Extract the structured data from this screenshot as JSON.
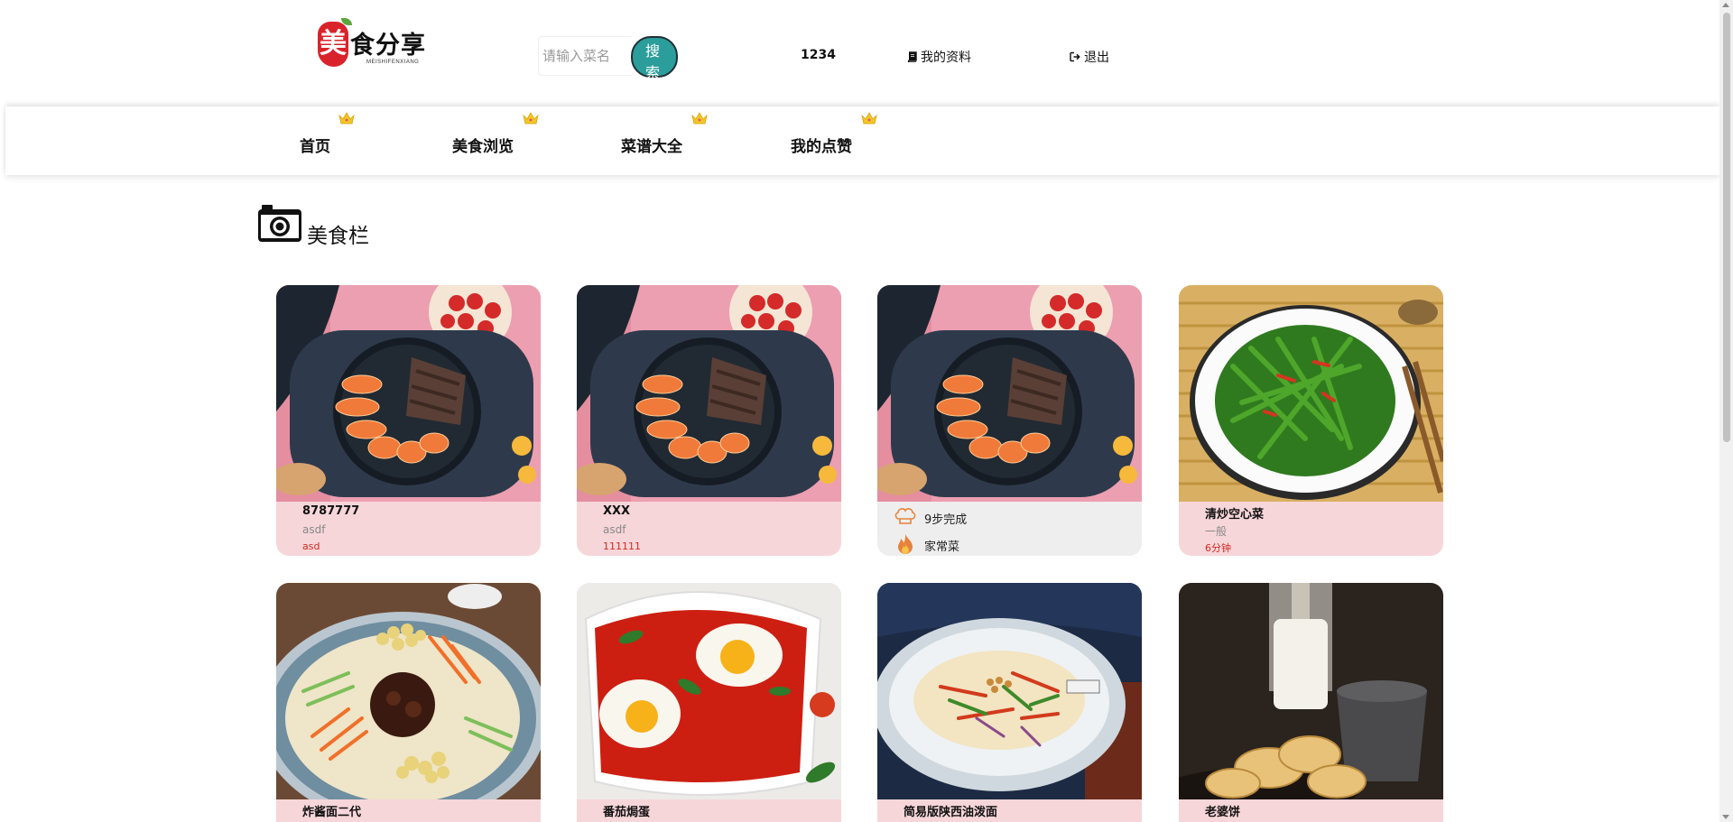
{
  "header": {
    "logo": {
      "char": "美",
      "text": "食分享",
      "subtitle": "MEISHIFENXIANG"
    },
    "search": {
      "placeholder": "请输入菜名",
      "button_label": "搜 索"
    },
    "user_id": "1234",
    "profile_label": "我的资料",
    "logout_label": "退出"
  },
  "nav": {
    "items": [
      {
        "label": "首页"
      },
      {
        "label": "美食浏览"
      },
      {
        "label": "菜谱大全"
      },
      {
        "label": "我的点赞"
      }
    ]
  },
  "section": {
    "title": "美食栏"
  },
  "cards": [
    {
      "name": "8787777",
      "desc": "asdf",
      "extra": "asd"
    },
    {
      "name": "XXX",
      "desc": "asdf",
      "extra": "111111"
    },
    {
      "steps": "9步完成",
      "tag": "家常菜"
    },
    {
      "name": "清炒空心菜",
      "desc": "一般",
      "extra": "6分钟"
    },
    {
      "name": "炸酱面二代"
    },
    {
      "name": "番茄焗蛋"
    },
    {
      "name": "简易版陕西油泼面"
    },
    {
      "name": "老婆饼"
    }
  ],
  "colors": {
    "accent_button": "#2b9d9a",
    "card_info_bg": "#f7d6da",
    "card_extra_text": "#d22b20",
    "logo_red": "#d9232b"
  },
  "icons": [
    "book-icon",
    "sign-out-icon",
    "crown-icon",
    "camera-icon",
    "chef-hat-icon",
    "fire-icon"
  ]
}
